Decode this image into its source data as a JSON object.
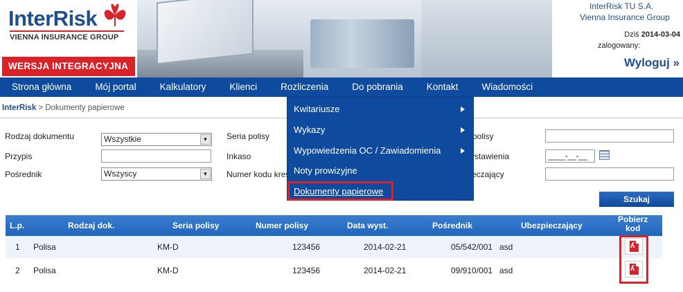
{
  "header": {
    "logo_text": "InterRisk",
    "logo_sub": "VIENNA INSURANCE GROUP",
    "version_badge": "WERSJA INTEGRACYJNA",
    "company_line1": "InterRisk TU S.A.",
    "company_line2": "Vienna Insurance Group",
    "today_label": "Dziś",
    "today_date": "2014-03-04",
    "logged_label": "zalogowany:",
    "logout_label": "Wyloguj"
  },
  "nav": {
    "items": [
      "Strona główna",
      "Mój portal",
      "Kalkulatory",
      "Klienci",
      "Rozliczenia",
      "Do pobrania",
      "Kontakt",
      "Wiadomości"
    ]
  },
  "breadcrumb": {
    "root": "InterRisk",
    "separator": ">",
    "current": "Dokumenty papierowe"
  },
  "dropdown": {
    "items": [
      "Kwitariusze",
      "Wykazy",
      "Wypowiedzenia OC / Zawiadomienia",
      "Noty prowizyjne"
    ],
    "selected": "Dokumenty papierowe"
  },
  "form": {
    "rodzaj_label": "Rodzaj dokumentu",
    "rodzaj_value": "Wszystkie",
    "przypis_label": "Przypis",
    "posrednik_label": "Pośrednik",
    "posrednik_value": "Wszyscy",
    "seria_label": "Seria polisy",
    "inkaso_label": "Inkaso",
    "numer_kodu_label": "Numer kodu kres",
    "nr_polisy_label": "polisy",
    "data_wyst_label": "ystawienia",
    "data_wyst_value": "____-__-__",
    "ubezp_label": "eczający",
    "search_label": "Szukaj"
  },
  "table": {
    "headers": {
      "lp": "L.p.",
      "rodzaj": "Rodzaj dok.",
      "seria": "Seria polisy",
      "numer": "Numer polisy",
      "data": "Data wyst.",
      "posrednik": "Pośrednik",
      "ubezp": "Ubezpieczający",
      "pobierz1": "Pobierz",
      "pobierz2": "kod"
    },
    "rows": [
      {
        "lp": "1",
        "rodzaj": "Polisa",
        "seria": "KM-D",
        "numer": "123456",
        "data": "2014-02-21",
        "posrednik": "05/542/001",
        "ubezp": "asd"
      },
      {
        "lp": "2",
        "rodzaj": "Polisa",
        "seria": "KM-D",
        "numer": "123456",
        "data": "2014-02-21",
        "posrednik": "09/910/001",
        "ubezp": "asd"
      }
    ]
  },
  "colors": {
    "brand_blue": "#0e4a9e",
    "brand_red": "#d8232a"
  }
}
